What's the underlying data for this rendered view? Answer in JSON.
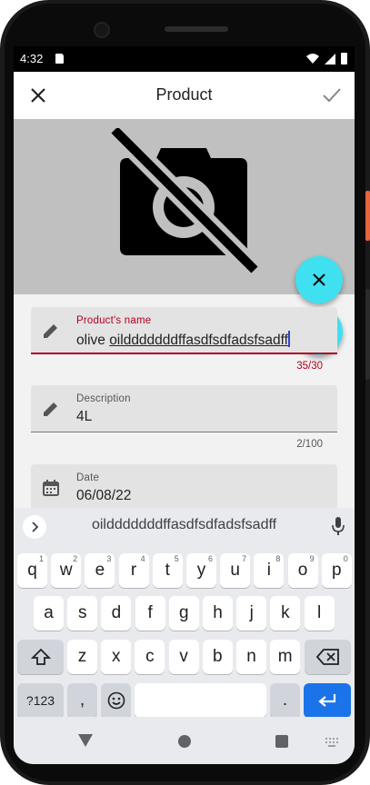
{
  "status_bar": {
    "time": "4:32"
  },
  "app_bar": {
    "title": "Product"
  },
  "fields": {
    "name": {
      "label": "Product's name",
      "value_plain": "olive ",
      "value_composing": "oildddddddffasdfsdfadsfsadff",
      "counter": "35/30"
    },
    "description": {
      "label": "Description",
      "value": "4L",
      "counter": "2/100"
    },
    "date": {
      "label": "Date",
      "value": "06/08/22"
    }
  },
  "keyboard": {
    "suggestion": "oildddddddffasdfsdfadsfsadff",
    "row1": [
      {
        "label": "q",
        "hint": "1"
      },
      {
        "label": "w",
        "hint": "2"
      },
      {
        "label": "e",
        "hint": "3"
      },
      {
        "label": "r",
        "hint": "4"
      },
      {
        "label": "t",
        "hint": "5"
      },
      {
        "label": "y",
        "hint": "6"
      },
      {
        "label": "u",
        "hint": "7"
      },
      {
        "label": "i",
        "hint": "8"
      },
      {
        "label": "o",
        "hint": "9"
      },
      {
        "label": "p",
        "hint": "0"
      }
    ],
    "row2": [
      "a",
      "s",
      "d",
      "f",
      "g",
      "h",
      "j",
      "k",
      "l"
    ],
    "row3": [
      "z",
      "x",
      "c",
      "v",
      "b",
      "n",
      "m"
    ],
    "symbols_label": "?123",
    "comma_label": ",",
    "period_label": "."
  },
  "colors": {
    "accent_fab": "#3fe0f0",
    "error": "#b00020",
    "enter_key": "#1a73e8"
  },
  "icons": {
    "app_close": "close-icon",
    "app_confirm": "check-icon",
    "image_placeholder": "no-photography-icon",
    "fab_clear": "close-icon",
    "fab_camera": "camera-icon",
    "name_field": "pencil-icon",
    "description_field": "pencil-icon",
    "date_field": "calendar-icon",
    "suggestion_expand": "chevron-right-icon",
    "voice_input": "mic-icon",
    "shift": "shift-icon",
    "backspace": "backspace-icon",
    "emoji": "emoji-icon",
    "enter": "enter-icon"
  }
}
